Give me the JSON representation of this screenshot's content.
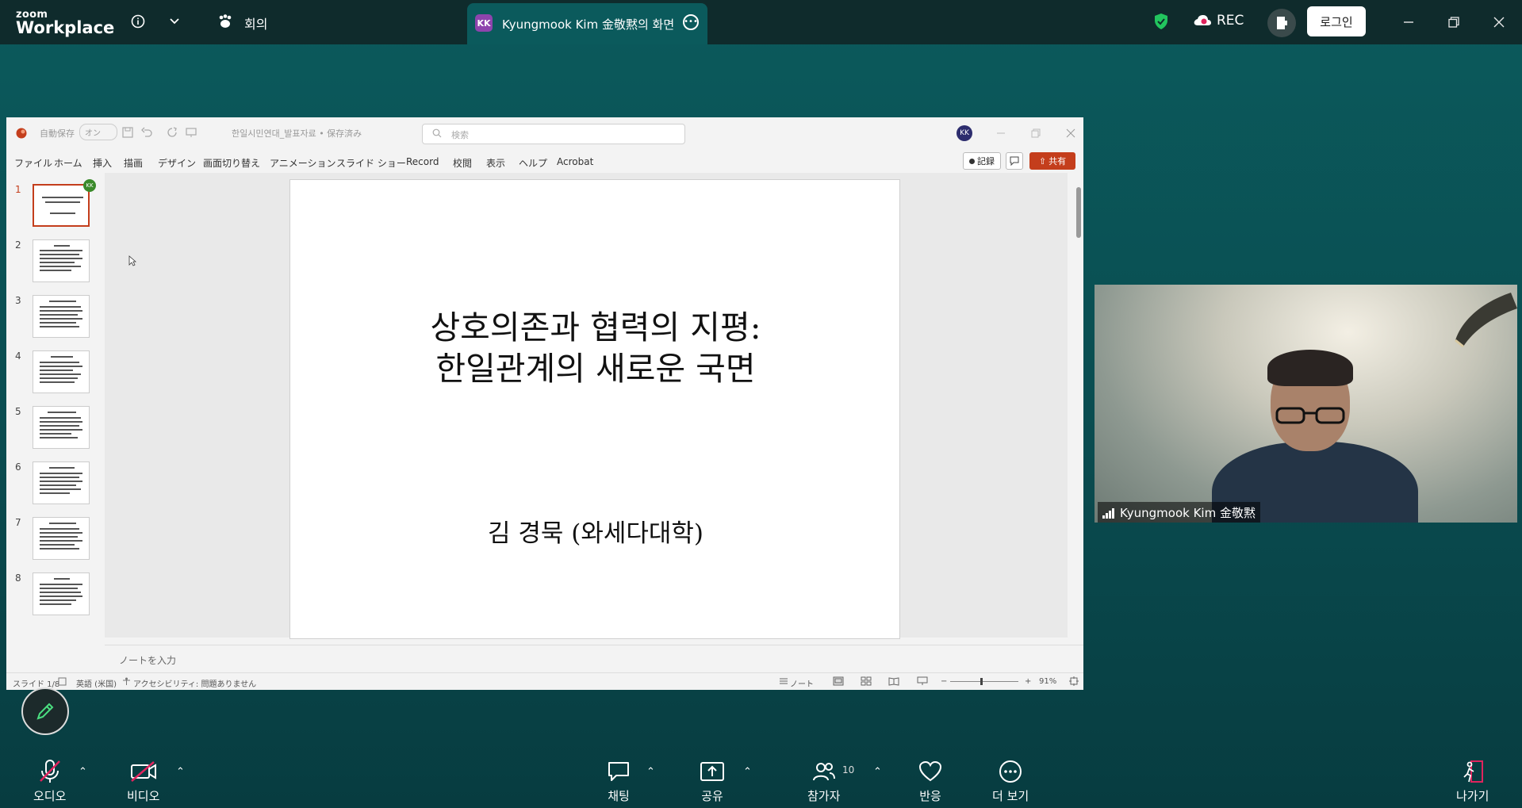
{
  "app": {
    "logo_line1": "zoom",
    "logo_line2": "Workplace",
    "meeting_label": "회의",
    "share_avatar": "KK",
    "share_title": "Kyungmook Kim 金敬黙의 화면",
    "rec_label": "REC",
    "login_label": "로그인"
  },
  "ppt": {
    "autosave_label": "自動保存",
    "autosave_state": "オン",
    "file_title": "한일시민연대_발표자료 • 保存済み",
    "search_placeholder": "検索",
    "user_initials": "KK",
    "menu": [
      "ファイル",
      "ホーム",
      "挿入",
      "描画",
      "デザイン",
      "画面切り替え",
      "アニメーション",
      "スライド ショー",
      "Record",
      "校閲",
      "表示",
      "ヘルプ",
      "Acrobat"
    ],
    "record_btn": "記録",
    "share_btn": "共有",
    "thumbnails": [
      "1",
      "2",
      "3",
      "4",
      "5",
      "6",
      "7",
      "8"
    ],
    "thumb_badge": "KK",
    "slide_title_line1": "상호의존과 협력의 지평:",
    "slide_title_line2": "한일관계의 새로운 국면",
    "slide_author": "김 경묵 (와세다대학)",
    "notes_placeholder": "ノートを入力",
    "status": {
      "slide_counter": "スライド 1/8",
      "language": "英語 (米国)",
      "accessibility": "アクセシビリティ: 問題ありません",
      "notes_btn": "ノート",
      "zoom": "91%"
    }
  },
  "video": {
    "participant_name": "Kyungmook Kim 金敬黙"
  },
  "toolbar": {
    "audio": "오디오",
    "video": "비디오",
    "chat": "채팅",
    "share": "공유",
    "participants": "참가자",
    "participants_count": "10",
    "reactions": "반응",
    "more": "더 보기",
    "leave": "나가기"
  },
  "colors": {
    "background": "#0b5a5c",
    "topbar": "#0f2b2c",
    "ppt_accent": "#c43e1c",
    "leave_accent": "#e0245e",
    "shield": "#22c55e"
  }
}
